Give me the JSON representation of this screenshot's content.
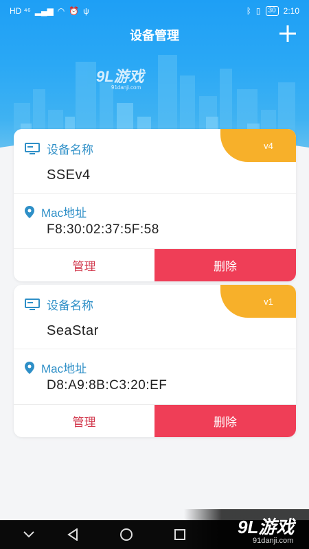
{
  "status_bar": {
    "left": "HD ⁴⁶",
    "battery": "30",
    "time": "2:10"
  },
  "header": {
    "title": "设备管理"
  },
  "watermark_top": {
    "logo": "9L游戏",
    "site": "91danji.com"
  },
  "devices": [
    {
      "name_label": "设备名称",
      "name": "SSEv4",
      "mac_label": "Mac地址",
      "mac": "F8:30:02:37:5F:58",
      "version": "v4",
      "manage_label": "管理",
      "delete_label": "删除"
    },
    {
      "name_label": "设备名称",
      "name": "SeaStar",
      "mac_label": "Mac地址",
      "mac": "D8:A9:8B:C3:20:EF",
      "version": "v1",
      "manage_label": "管理",
      "delete_label": "删除"
    }
  ],
  "watermark_bottom": {
    "logo": "9L游戏",
    "site": "91danji.com"
  },
  "colors": {
    "header_blue": "#1e9ff5",
    "label_blue": "#2e8fc7",
    "version_orange": "#f7b02a",
    "delete_red": "#ef3e57",
    "manage_text": "#d23a4e"
  },
  "icons": [
    "monitor-icon",
    "location-pin-icon",
    "plus-icon",
    "back-icon",
    "home-icon",
    "recents-icon",
    "collapse-icon"
  ]
}
